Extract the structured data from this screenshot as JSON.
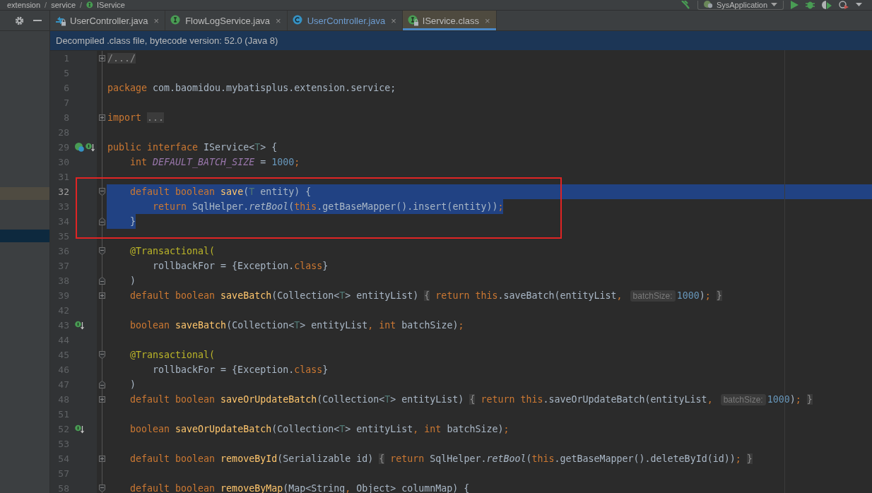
{
  "breadcrumbs": [
    {
      "kind": "crumb",
      "label": "extension"
    },
    {
      "kind": "sep",
      "label": "/"
    },
    {
      "kind": "crumb",
      "label": "service"
    },
    {
      "kind": "sep",
      "label": "/"
    },
    {
      "kind": "interface",
      "label": "IService"
    }
  ],
  "toolbar": {
    "run_configuration": "SysApplication"
  },
  "project_panel": {
    "rows": [
      {
        "kind": "highlight"
      },
      {
        "kind": "selection"
      }
    ]
  },
  "tabs": [
    {
      "label": "UserController.java",
      "kind": "arrows",
      "locked": true,
      "selected": false,
      "color": "#bbbbbb",
      "close": "×"
    },
    {
      "label": "FlowLogService.java",
      "kind": "interface",
      "locked": false,
      "selected": false,
      "color": "#bbbbbb",
      "close": "×"
    },
    {
      "label": "UserController.java",
      "kind": "class",
      "locked": false,
      "selected": false,
      "color": "#6d9cd0",
      "close": "×"
    },
    {
      "label": "IService.class",
      "kind": "interface",
      "locked": true,
      "selected": true,
      "color": "#bbbbbb",
      "close": "×"
    }
  ],
  "banner": "Decompiled .class file, bytecode version: 52.0 (Java 8)",
  "editor": {
    "lines": [
      {
        "number": "1",
        "fold_marker": {
          "kind": "expand"
        },
        "selected": false,
        "current": false,
        "boxed": false,
        "tokens": [
          {
            "kind": "fold",
            "text": "/.../"
          }
        ]
      },
      {
        "number": "5",
        "selected": false,
        "current": false,
        "boxed": false
      },
      {
        "number": "6",
        "selected": false,
        "current": false,
        "boxed": false,
        "tokens": [
          {
            "kind": "kw",
            "text": "package"
          },
          {
            "kind": "plain",
            "text": " com.baomidou.mybatisplus.extension.service;"
          }
        ]
      },
      {
        "number": "7",
        "selected": false,
        "current": false,
        "boxed": false
      },
      {
        "number": "8",
        "fold_marker": {
          "kind": "expand"
        },
        "selected": false,
        "current": false,
        "boxed": false,
        "tokens": [
          {
            "kind": "kw",
            "text": "import "
          },
          {
            "kind": "fold",
            "text": "..."
          }
        ]
      },
      {
        "number": "28",
        "selected": false,
        "current": false,
        "boxed": false
      },
      {
        "number": "29",
        "gutter_icons": [
          {
            "kind": "implemented"
          },
          {
            "kind": "overrides"
          }
        ],
        "selected": false,
        "current": false,
        "boxed": false,
        "tokens": [
          {
            "kind": "kw",
            "text": "public interface"
          },
          {
            "kind": "plain",
            "text": " IService<"
          },
          {
            "kind": "tparam",
            "text": "T"
          },
          {
            "kind": "plain",
            "text": "> {"
          }
        ]
      },
      {
        "number": "30",
        "selected": false,
        "current": false,
        "boxed": false,
        "tokens": [
          {
            "kind": "kw",
            "text": "    int"
          },
          {
            "kind": "const",
            "text": " DEFAULT_BATCH_SIZE"
          },
          {
            "kind": "plain",
            "text": " = "
          },
          {
            "kind": "num",
            "text": "1000"
          },
          {
            "kind": "kw",
            "text": ";"
          }
        ]
      },
      {
        "number": "31",
        "selected": false,
        "current": false,
        "boxed": false
      },
      {
        "number": "32",
        "fold_marker": {
          "kind": "start"
        },
        "selected": true,
        "current": true,
        "boxed": true,
        "tokens": [
          {
            "kind": "kw",
            "text": "    default boolean "
          },
          {
            "kind": "decl",
            "text": "save"
          },
          {
            "kind": "plain",
            "text": "("
          },
          {
            "kind": "tparam",
            "text": "T"
          },
          {
            "kind": "plain",
            "text": " entity) {"
          }
        ]
      },
      {
        "number": "33",
        "selected": true,
        "current": false,
        "boxed": true,
        "tokens": [
          {
            "kind": "kw",
            "text": "        return "
          },
          {
            "kind": "plain",
            "text": "SqlHelper."
          },
          {
            "kind": "italic",
            "text": "retBool"
          },
          {
            "kind": "plain",
            "text": "("
          },
          {
            "kind": "kw",
            "text": "this"
          },
          {
            "kind": "plain",
            "text": ".getBaseMapper().insert(entity))"
          },
          {
            "kind": "kw",
            "text": ";"
          }
        ]
      },
      {
        "number": "34",
        "fold_marker": {
          "kind": "end"
        },
        "selected": true,
        "current": false,
        "boxed": true,
        "tokens": [
          {
            "kind": "plain",
            "text": "    }"
          }
        ]
      },
      {
        "number": "35",
        "selected": false,
        "current": false,
        "boxed": false
      },
      {
        "number": "36",
        "fold_marker": {
          "kind": "start"
        },
        "selected": false,
        "current": false,
        "boxed": false,
        "tokens": [
          {
            "kind": "annot",
            "text": "    @Transactional("
          }
        ]
      },
      {
        "number": "37",
        "selected": false,
        "current": false,
        "boxed": false,
        "tokens": [
          {
            "kind": "plain",
            "text": "        rollbackFor = {Exception."
          },
          {
            "kind": "kw",
            "text": "class"
          },
          {
            "kind": "plain",
            "text": "}"
          }
        ]
      },
      {
        "number": "38",
        "fold_marker": {
          "kind": "end"
        },
        "selected": false,
        "current": false,
        "boxed": false,
        "tokens": [
          {
            "kind": "plain",
            "text": "    )"
          }
        ]
      },
      {
        "number": "39",
        "fold_marker": {
          "kind": "expand"
        },
        "selected": false,
        "current": false,
        "boxed": false,
        "tokens": [
          {
            "kind": "kw",
            "text": "    default boolean "
          },
          {
            "kind": "decl",
            "text": "saveBatch"
          },
          {
            "kind": "plain",
            "text": "(Collection<"
          },
          {
            "kind": "tparam",
            "text": "T"
          },
          {
            "kind": "plain",
            "text": "> entityList) "
          },
          {
            "kind": "fold",
            "text": "{"
          },
          {
            "kind": "kw",
            "text": " return this"
          },
          {
            "kind": "plain",
            "text": ".saveBatch(entityList"
          },
          {
            "kind": "kw",
            "text": ", "
          },
          {
            "kind": "hint",
            "text": "batchSize:"
          },
          {
            "kind": "num",
            "text": "1000"
          },
          {
            "kind": "plain",
            "text": ")"
          },
          {
            "kind": "kw",
            "text": "; "
          },
          {
            "kind": "fold",
            "text": "}"
          }
        ]
      },
      {
        "number": "42",
        "selected": false,
        "current": false,
        "boxed": false
      },
      {
        "number": "43",
        "gutter_icons": [
          {
            "kind": "overrides"
          }
        ],
        "selected": false,
        "current": false,
        "boxed": false,
        "tokens": [
          {
            "kind": "kw",
            "text": "    boolean "
          },
          {
            "kind": "decl",
            "text": "saveBatch"
          },
          {
            "kind": "plain",
            "text": "(Collection<"
          },
          {
            "kind": "tparam",
            "text": "T"
          },
          {
            "kind": "plain",
            "text": "> entityList"
          },
          {
            "kind": "kw",
            "text": ", int "
          },
          {
            "kind": "plain",
            "text": "batchSize)"
          },
          {
            "kind": "kw",
            "text": ";"
          }
        ]
      },
      {
        "number": "44",
        "selected": false,
        "current": false,
        "boxed": false
      },
      {
        "number": "45",
        "fold_marker": {
          "kind": "start"
        },
        "selected": false,
        "current": false,
        "boxed": false,
        "tokens": [
          {
            "kind": "annot",
            "text": "    @Transactional("
          }
        ]
      },
      {
        "number": "46",
        "selected": false,
        "current": false,
        "boxed": false,
        "tokens": [
          {
            "kind": "plain",
            "text": "        rollbackFor = {Exception."
          },
          {
            "kind": "kw",
            "text": "class"
          },
          {
            "kind": "plain",
            "text": "}"
          }
        ]
      },
      {
        "number": "47",
        "fold_marker": {
          "kind": "end"
        },
        "selected": false,
        "current": false,
        "boxed": false,
        "tokens": [
          {
            "kind": "plain",
            "text": "    )"
          }
        ]
      },
      {
        "number": "48",
        "fold_marker": {
          "kind": "expand"
        },
        "selected": false,
        "current": false,
        "boxed": false,
        "tokens": [
          {
            "kind": "kw",
            "text": "    default boolean "
          },
          {
            "kind": "decl",
            "text": "saveOrUpdateBatch"
          },
          {
            "kind": "plain",
            "text": "(Collection<"
          },
          {
            "kind": "tparam",
            "text": "T"
          },
          {
            "kind": "plain",
            "text": "> entityList) "
          },
          {
            "kind": "fold",
            "text": "{"
          },
          {
            "kind": "kw",
            "text": " return this"
          },
          {
            "kind": "plain",
            "text": ".saveOrUpdateBatch(entityList"
          },
          {
            "kind": "kw",
            "text": ", "
          },
          {
            "kind": "hint",
            "text": "batchSize:"
          },
          {
            "kind": "num",
            "text": "1000"
          },
          {
            "kind": "plain",
            "text": ")"
          },
          {
            "kind": "kw",
            "text": "; "
          },
          {
            "kind": "fold",
            "text": "}"
          }
        ]
      },
      {
        "number": "51",
        "selected": false,
        "current": false,
        "boxed": false
      },
      {
        "number": "52",
        "gutter_icons": [
          {
            "kind": "overrides"
          }
        ],
        "selected": false,
        "current": false,
        "boxed": false,
        "tokens": [
          {
            "kind": "kw",
            "text": "    boolean "
          },
          {
            "kind": "decl",
            "text": "saveOrUpdateBatch"
          },
          {
            "kind": "plain",
            "text": "(Collection<"
          },
          {
            "kind": "tparam",
            "text": "T"
          },
          {
            "kind": "plain",
            "text": "> entityList"
          },
          {
            "kind": "kw",
            "text": ", int "
          },
          {
            "kind": "plain",
            "text": "batchSize)"
          },
          {
            "kind": "kw",
            "text": ";"
          }
        ]
      },
      {
        "number": "53",
        "selected": false,
        "current": false,
        "boxed": false
      },
      {
        "number": "54",
        "fold_marker": {
          "kind": "expand"
        },
        "selected": false,
        "current": false,
        "boxed": false,
        "tokens": [
          {
            "kind": "kw",
            "text": "    default boolean "
          },
          {
            "kind": "decl",
            "text": "removeById"
          },
          {
            "kind": "plain",
            "text": "(Serializable id) "
          },
          {
            "kind": "fold",
            "text": "{"
          },
          {
            "kind": "kw",
            "text": " return "
          },
          {
            "kind": "plain",
            "text": "SqlHelper."
          },
          {
            "kind": "italic",
            "text": "retBool"
          },
          {
            "kind": "plain",
            "text": "("
          },
          {
            "kind": "kw",
            "text": "this"
          },
          {
            "kind": "plain",
            "text": ".getBaseMapper().deleteById(id))"
          },
          {
            "kind": "kw",
            "text": "; "
          },
          {
            "kind": "fold",
            "text": "}"
          }
        ]
      },
      {
        "number": "57",
        "selected": false,
        "current": false,
        "boxed": false
      },
      {
        "number": "58",
        "fold_marker": {
          "kind": "start"
        },
        "selected": false,
        "current": false,
        "boxed": false,
        "tokens": [
          {
            "kind": "kw",
            "text": "    default boolean "
          },
          {
            "kind": "decl",
            "text": "removeByMap"
          },
          {
            "kind": "plain",
            "text": "(Map<String"
          },
          {
            "kind": "kw",
            "text": ", "
          },
          {
            "kind": "plain",
            "text": "Object> columnMap) {"
          }
        ]
      }
    ]
  }
}
